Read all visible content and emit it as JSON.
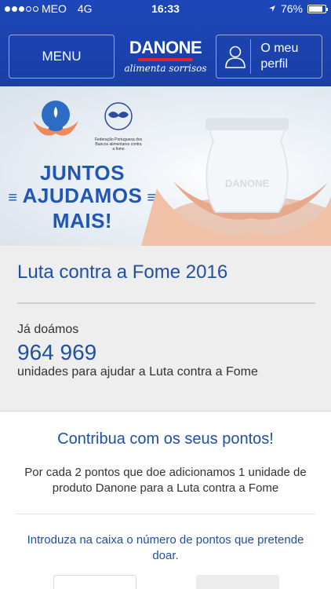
{
  "status_bar": {
    "carrier": "MEO",
    "network": "4G",
    "time": "16:33",
    "battery": "76%"
  },
  "header": {
    "menu_label": "MENU",
    "logo_brand": "DANONE",
    "logo_tagline": "alimenta sorrisos",
    "profile_label": "O meu perfil"
  },
  "hero": {
    "title_line1": "JUNTOS",
    "title_line2": "AJUDAMOS",
    "title_line3": "MAIS!",
    "org_caption": "Federação Portuguesa dos Bancos alimentares contra a fome",
    "product_text": "DANONE"
  },
  "stats": {
    "title": "Luta contra a Fome 2016",
    "donated_label": "Já doámos",
    "donated_value": "964 969",
    "donated_desc": "unidades para ajudar a Luta contra a Fome"
  },
  "contribute": {
    "title": "Contribua com os seus pontos!",
    "description": "Por cada 2 pontos que doe adicionamos 1 unidade de produto Danone para a Luta contra a Fome",
    "instruction": "Introduza na caixa o número de pontos que pretende doar."
  },
  "colors": {
    "brand_blue": "#1c47b8",
    "text_blue": "#1f4fa6",
    "stats_bg": "#eeeeee"
  }
}
